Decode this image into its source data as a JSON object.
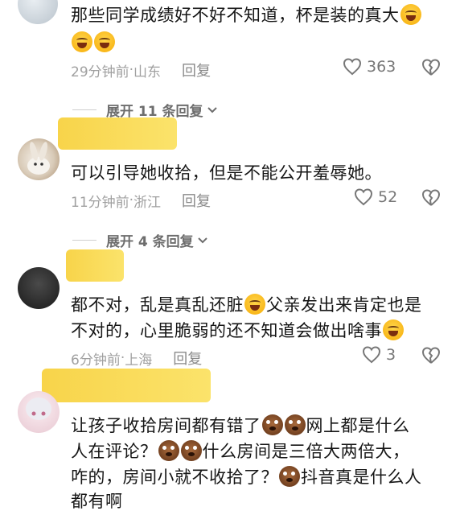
{
  "comments": [
    {
      "text_parts": [
        "那些同学成绩好不好不知道，杯是装的真大"
      ],
      "emoji_line2": [
        "laugh",
        "laugh"
      ],
      "time": "29分钟前",
      "location": "山东",
      "reply_label": "回复",
      "likes": "363",
      "expand_label": "展开 11 条回复"
    },
    {
      "text": "可以引导她收拾，但是不能公开羞辱她。",
      "time": "11分钟前",
      "location": "浙江",
      "reply_label": "回复",
      "likes": "52",
      "expand_label": "展开 4 条回复"
    },
    {
      "line1": "都不对，乱是真乱还脏",
      "line1b": "父亲发出来肯定也是",
      "line2": "不对的，心里脆弱的还不知道会做出啥事",
      "time": "6分钟前",
      "location": "上海",
      "reply_label": "回复",
      "likes": "3"
    },
    {
      "line1a": "让孩子收拾房间都有错了",
      "line1b": "网上都是什么",
      "line2a": "人在评论？",
      "line2b": "什么房间是三倍大两倍大，",
      "line3a": "咋的，房间小就不收拾了？",
      "line3b": "抖音真是什么人",
      "line4": "都有啊"
    }
  ],
  "colors": {
    "highlight": "#f8d44a",
    "meta": "#a0a0a0",
    "text": "#161616"
  },
  "icons": [
    "heart-icon",
    "broken-heart-icon",
    "chevron-down-icon",
    "laughing-emoji-icon",
    "dog-emoji-icon"
  ]
}
